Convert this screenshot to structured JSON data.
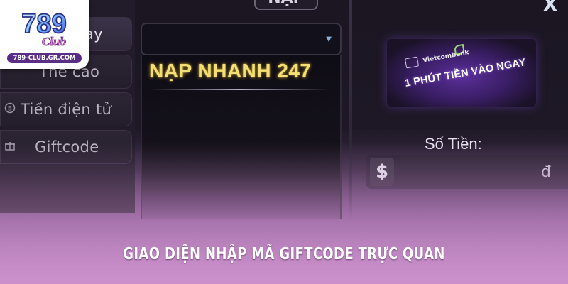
{
  "top_tab": {
    "label": "NẠP"
  },
  "close": {
    "label": "X"
  },
  "logo": {
    "mark_text": "789",
    "sub_text": "Club",
    "url": "789-CLUB.GR.COM"
  },
  "sidebar": {
    "items": [
      {
        "label": "ay",
        "icon": "",
        "active": true
      },
      {
        "label": "Thẻ cào",
        "icon": "",
        "active": false
      },
      {
        "label": "Tiền điện tử",
        "icon": "bitcoin-icon",
        "glyph": "B",
        "active": false
      },
      {
        "label": "Giftcode",
        "icon": "gift-icon",
        "glyph": "✚",
        "active": false
      }
    ]
  },
  "dropdown": {
    "caret": "▼",
    "selected_option": "NẠP NHANH 247"
  },
  "banner": {
    "bank_name": "Vietcombank",
    "headline": "1 PHÚT TIỀN VÀO NGAY"
  },
  "amount": {
    "label": "Số Tiền:",
    "symbol": "$",
    "currency": "đ",
    "value": ""
  },
  "caption": {
    "text": "GIAO DIỆN NHẬP MÃ GIFTCODE TRỰC QUAN"
  },
  "colors": {
    "accent_gold": "#f3df74",
    "panel_dark": "#221c2a",
    "caption_bg": "#c890c9"
  }
}
